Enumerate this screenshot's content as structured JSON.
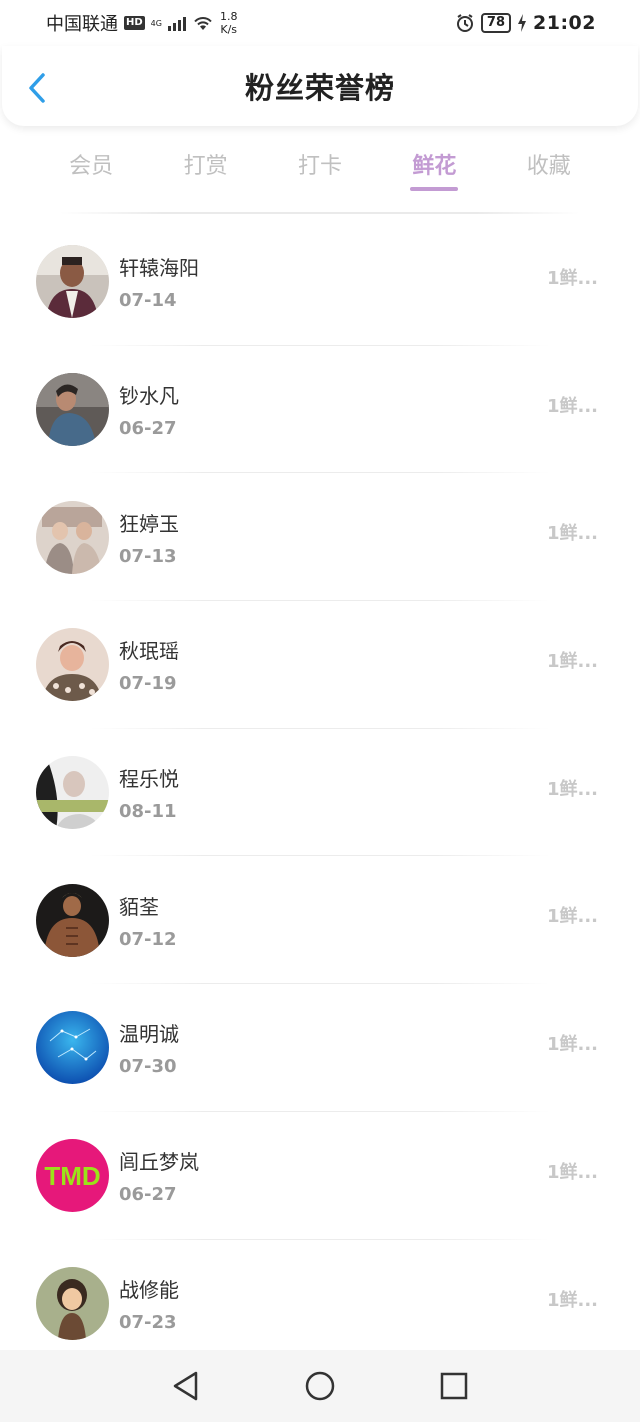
{
  "status": {
    "carrier": "中国联通",
    "hd": "HD",
    "network": "4G",
    "speed_value": "1.8",
    "speed_unit": "K/s",
    "battery": "78",
    "time": "21:02"
  },
  "header": {
    "title": "粉丝荣誉榜",
    "back_icon": "chevron-left-icon"
  },
  "tabs": [
    {
      "label": "会员",
      "active": false
    },
    {
      "label": "打赏",
      "active": false
    },
    {
      "label": "打卡",
      "active": false
    },
    {
      "label": "鲜花",
      "active": true
    },
    {
      "label": "收藏",
      "active": false
    }
  ],
  "list": [
    {
      "name": "轩辕海阳",
      "date": "07-14",
      "gift": "1鲜..."
    },
    {
      "name": "钞水凡",
      "date": "06-27",
      "gift": "1鲜..."
    },
    {
      "name": "狂婷玉",
      "date": "07-13",
      "gift": "1鲜..."
    },
    {
      "name": "秋珉瑶",
      "date": "07-19",
      "gift": "1鲜..."
    },
    {
      "name": "程乐悦",
      "date": "08-11",
      "gift": "1鲜..."
    },
    {
      "name": "貊荃",
      "date": "07-12",
      "gift": "1鲜..."
    },
    {
      "name": "温明诚",
      "date": "07-30",
      "gift": "1鲜..."
    },
    {
      "name": "闾丘梦岚",
      "date": "06-27",
      "gift": "1鲜..."
    },
    {
      "name": "战修能",
      "date": "07-23",
      "gift": "1鲜..."
    }
  ],
  "avatars": {
    "avatar_8_text": "TMD"
  },
  "colors": {
    "accent": "#c39bd3",
    "back_arrow": "#2f9ee8",
    "tab_inactive": "#c0c0c0"
  },
  "nav": [
    "back-triangle-icon",
    "home-circle-icon",
    "recents-square-icon"
  ]
}
